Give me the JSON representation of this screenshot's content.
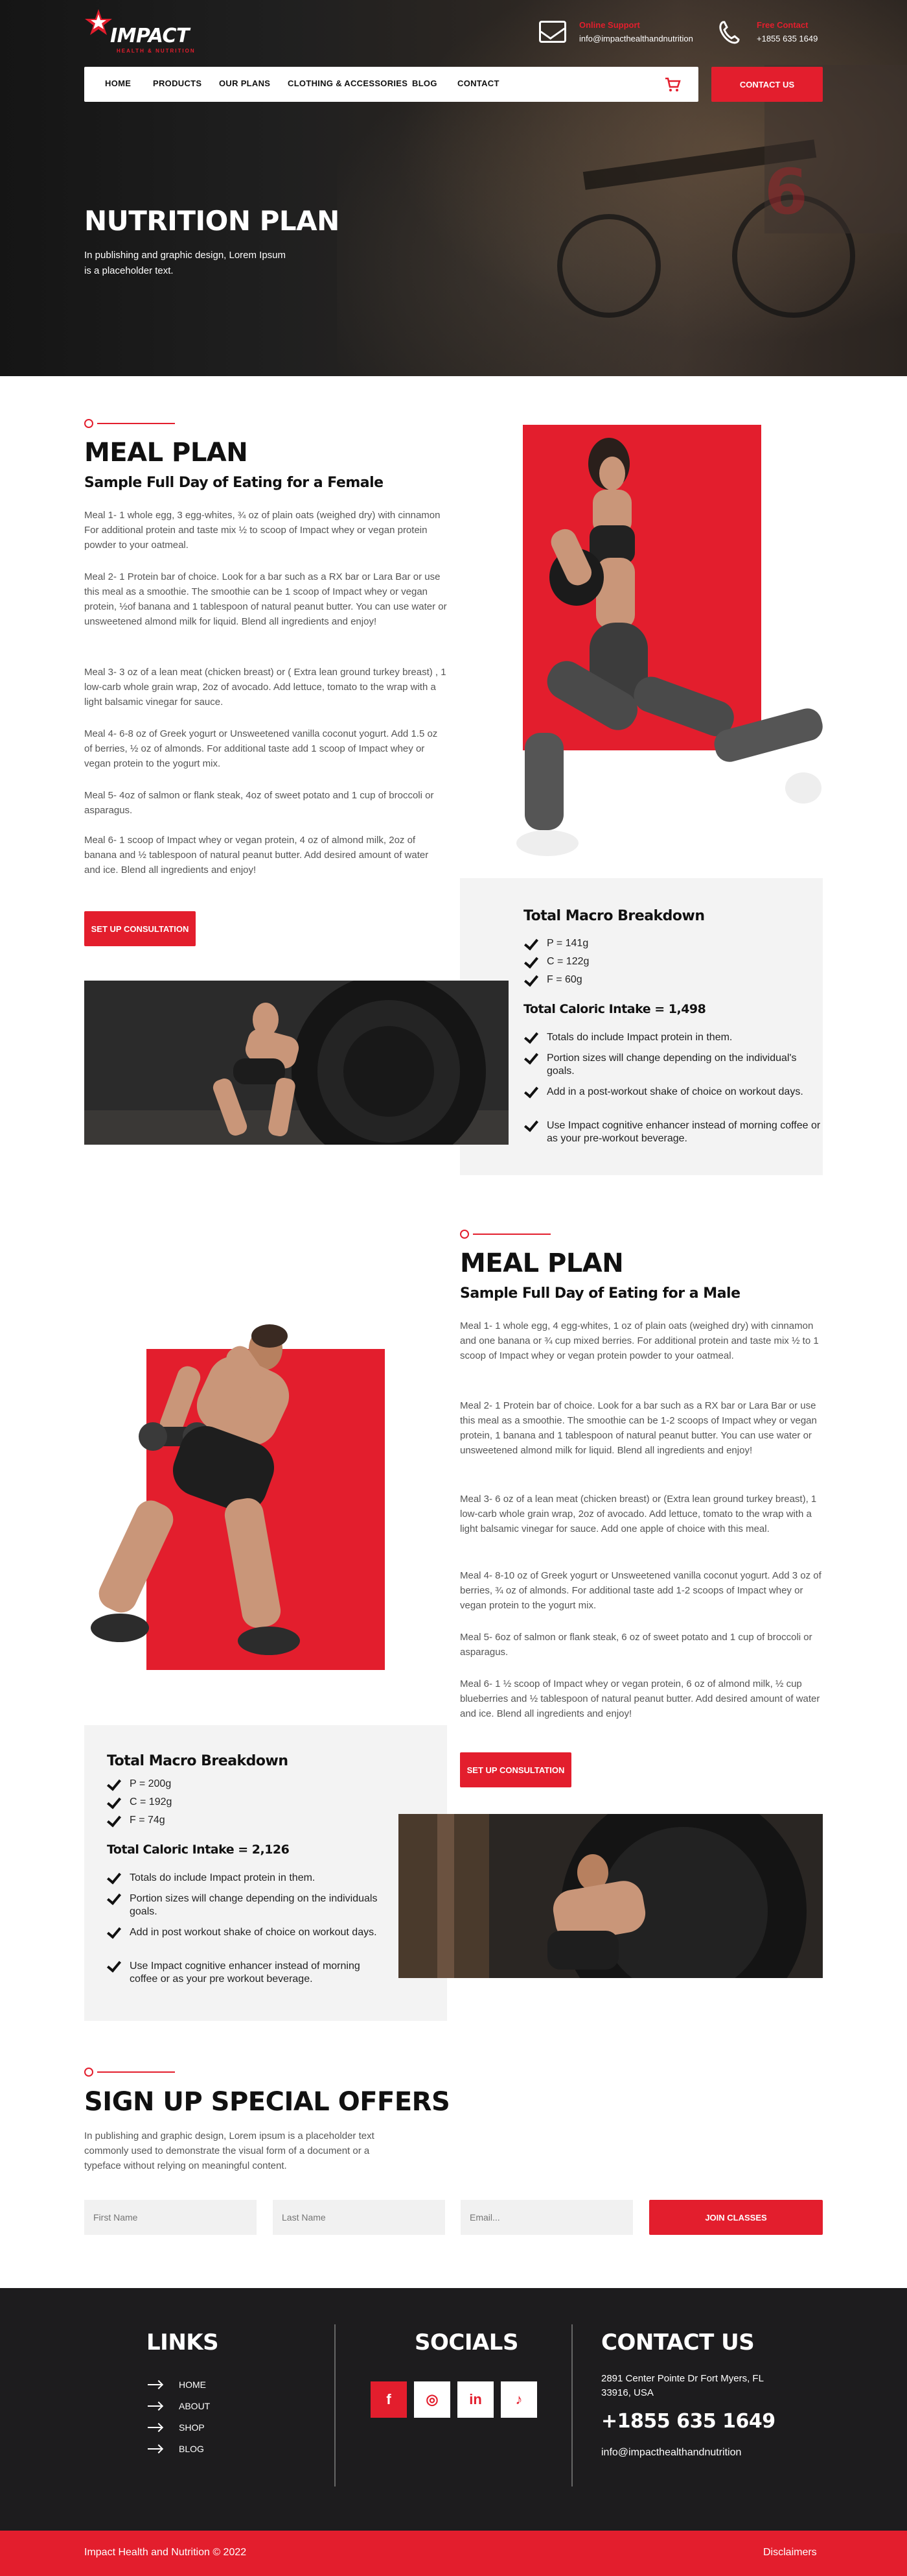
{
  "header": {
    "logo_text": "IMPACT",
    "logo_tagline": "HEALTH & NUTRITION",
    "email_label": "Online Support",
    "email_value": "info@impacthealthandnutrition",
    "phone_label": "Free Contact",
    "phone_value": "+1855 635 1649"
  },
  "nav": {
    "items": [
      "HOME",
      "PRODUCTS",
      "OUR PLANS",
      "CLOTHING & ACCESSORIES",
      "BLOG",
      "CONTACT"
    ],
    "cta": "CONTACT US"
  },
  "hero": {
    "title": "NUTRITION PLAN",
    "text": "In publishing and graphic design, Lorem Ipsum is a placeholder text."
  },
  "female": {
    "title": "MEAL PLAN",
    "subtitle": "Sample Full Day of Eating for a Female",
    "meals": [
      "Meal 1- 1 whole egg, 3 egg-whites, ¾ oz of plain oats (weighed dry) with cinnamon For additional protein and taste mix ½ to scoop of Impact whey or vegan protein powder to your oatmeal.",
      "Meal 2- 1 Protein bar of choice. Look for a bar such as a RX bar or Lara Bar or use this meal as a smoothie. The smoothie can be 1 scoop of Impact whey or vegan protein, ½of banana and 1 tablespoon of natural peanut butter. You can use water or unsweetened almond milk for liquid. Blend all ingredients and enjoy!",
      "Meal 3- 3 oz of a lean meat (chicken breast) or ( Extra lean ground turkey breast) , 1 low-carb whole grain wrap, 2oz of avocado. Add lettuce, tomato to the wrap with a light balsamic vinegar for sauce.",
      "Meal 4- 6-8 oz of Greek yogurt or Unsweetened vanilla coconut yogurt. Add 1.5 oz of berries, ½ oz of almonds. For additional taste add 1 scoop of Impact whey or vegan protein to the yogurt mix.",
      "Meal 5- 4oz of salmon or flank steak, 4oz of sweet potato and 1 cup of broccoli or asparagus.",
      "Meal 6- 1 scoop of Impact whey or vegan protein, 4 oz of almond milk, 2oz of banana and ½ tablespoon of natural peanut butter. Add desired amount of water and ice. Blend all ingredients and enjoy!"
    ],
    "cta": "SET UP CONSULTATION",
    "macro_title": "Total Macro Breakdown",
    "macros": [
      "P = 141g",
      "C = 122g",
      "F = 60g"
    ],
    "caloric": "Total Caloric Intake = 1,498",
    "notes": [
      "Totals do include Impact protein in them.",
      "Portion sizes will change depending on the individual's goals.",
      "Add in a post-workout shake of choice on workout days.",
      "Use Impact cognitive enhancer instead of morning coffee or as your pre-workout beverage."
    ]
  },
  "male": {
    "title": "MEAL PLAN",
    "subtitle": "Sample Full Day of Eating for a Male",
    "meals": [
      "Meal 1- 1 whole egg, 4 egg-whites, 1 oz of plain oats (weighed dry) with cinnamon and one banana or ¾ cup mixed berries. For additional protein and taste mix ½ to 1 scoop of Impact whey or vegan protein powder to your oatmeal.",
      "Meal 2- 1 Protein bar of choice. Look for a bar such as a RX bar or Lara Bar or use this meal as a smoothie. The smoothie can be 1-2 scoops of Impact whey or vegan protein, 1 banana and 1 tablespoon of natural peanut butter. You can use water or unsweetened almond milk for liquid. Blend all ingredients and enjoy!",
      "Meal 3- 6 oz of a lean meat (chicken breast) or (Extra lean ground turkey breast), 1 low-carb whole grain wrap, 2oz of avocado. Add lettuce, tomato to the wrap with a light balsamic vinegar for sauce. Add one apple of choice with this meal.",
      "Meal 4- 8-10 oz of Greek yogurt or Unsweetened vanilla coconut yogurt. Add 3 oz of berries, ¾ oz of almonds. For additional taste add 1-2 scoops of Impact whey or vegan protein to the yogurt mix.",
      "Meal 5- 6oz of salmon or flank steak, 6 oz of sweet potato and 1 cup of broccoli or asparagus.",
      "Meal 6- 1 ½ scoop of Impact whey or vegan protein, 6 oz of almond milk, ½ cup blueberries and ½ tablespoon of natural peanut butter. Add desired amount of water and ice. Blend all ingredients and enjoy!"
    ],
    "cta": "SET UP CONSULTATION",
    "macro_title": "Total Macro Breakdown",
    "macros": [
      "P = 200g",
      "C = 192g",
      "F = 74g"
    ],
    "caloric": "Total Caloric Intake = 2,126",
    "notes": [
      "Totals do include Impact protein in them.",
      "Portion sizes will change depending on the individuals goals.",
      "Add in post workout shake of choice on workout days.",
      "Use Impact cognitive enhancer instead of morning coffee or as your pre workout beverage."
    ]
  },
  "signup": {
    "title": "SIGN UP SPECIAL OFFERS",
    "text": "In publishing and graphic design, Lorem ipsum is a placeholder text commonly used to demonstrate the visual form of a document or a typeface without relying on meaningful content.",
    "first_name_placeholder": "First Name",
    "last_name_placeholder": "Last Name",
    "email_placeholder": "Email...",
    "button": "JOIN CLASSES"
  },
  "footer": {
    "links_title": "LINKS",
    "links": [
      "HOME",
      "ABOUT",
      "SHOP",
      "BLOG"
    ],
    "socials_title": "SOCIALS",
    "socials": [
      "f",
      "◎",
      "in",
      "♪"
    ],
    "contact_title": "CONTACT US",
    "address": "2891 Center Pointe Dr Fort Myers, FL 33916, USA",
    "phone": "+1855 635 1649",
    "email": "info@impacthealthandnutrition",
    "copyright": "Impact Health and Nutrition © 2022",
    "disclaimers": "Disclaimers"
  },
  "colors": {
    "accent": "#e31e2d",
    "dark": "#1d1c1e",
    "panel": "#f3f3f3"
  }
}
